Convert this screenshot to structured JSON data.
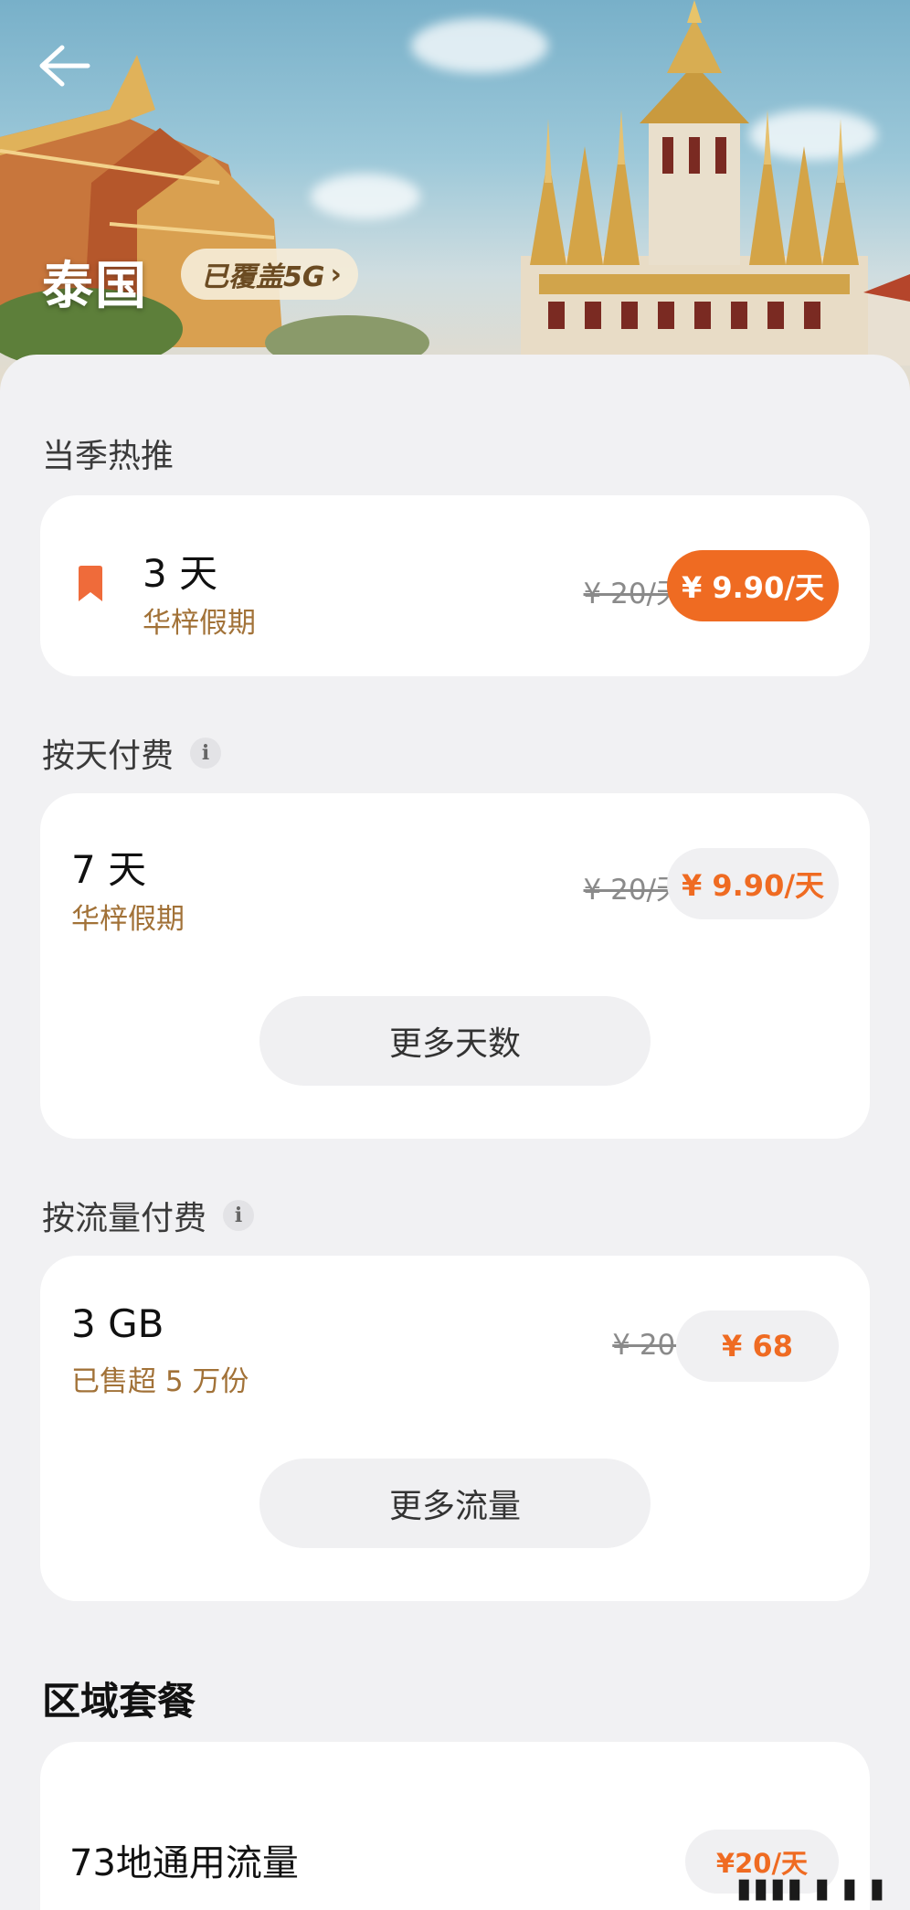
{
  "header": {
    "back_icon": "arrow-left-icon",
    "country": "泰国",
    "coverage_badge": "已覆盖5G",
    "badge_chevron": "›"
  },
  "sections": {
    "seasonal": {
      "title": "当季热推",
      "plan": {
        "icon": "bookmark-icon",
        "name": "3 天",
        "sub": "华梓假期",
        "old_price": "¥ 20/天",
        "price": "¥ 9.90/天"
      }
    },
    "daily": {
      "title": "按天付费",
      "info_icon": "i",
      "plan": {
        "name": "7 天",
        "sub": "华梓假期",
        "old_price": "¥ 20/天",
        "price": "¥ 9.90/天"
      },
      "more_button": "更多天数"
    },
    "traffic": {
      "title": "按流量付费",
      "info_icon": "i",
      "plan": {
        "name": "3 GB",
        "sub": "已售超 5 万份",
        "old_price": "¥ 204",
        "price": "¥ 68"
      },
      "more_button": "更多流量"
    },
    "regional": {
      "title": "区域套餐",
      "plan": {
        "name": "73地通用流量",
        "price": "¥20/天"
      }
    }
  },
  "colors": {
    "accent_orange": "#ef6b22",
    "gold_text": "#a27238",
    "background": "#f1f1f3"
  }
}
